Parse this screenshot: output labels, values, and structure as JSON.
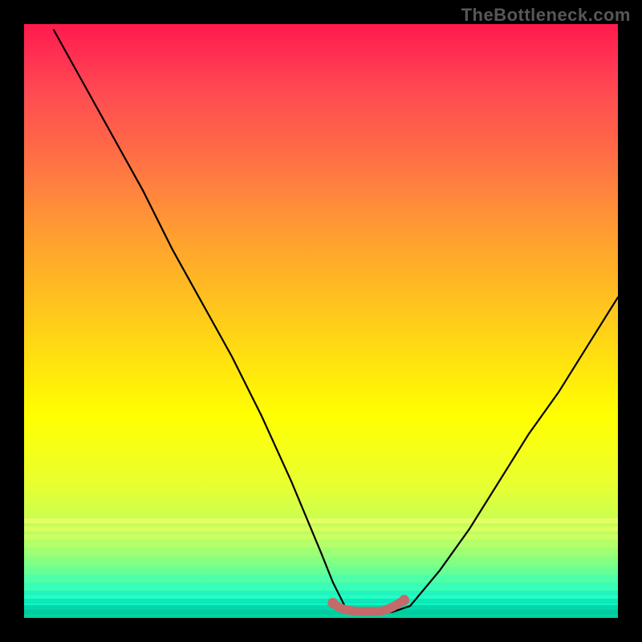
{
  "watermark": "TheBottleneck.com",
  "chart_data": {
    "type": "line",
    "title": "",
    "xlabel": "",
    "ylabel": "",
    "xlim": [
      0,
      100
    ],
    "ylim": [
      0,
      100
    ],
    "series": [
      {
        "name": "bottleneck-curve",
        "x": [
          5,
          10,
          15,
          20,
          25,
          30,
          35,
          40,
          45,
          50,
          52,
          54,
          56,
          58,
          60,
          62,
          65,
          70,
          75,
          80,
          85,
          90,
          95,
          100
        ],
        "y": [
          99,
          90,
          81,
          72,
          62,
          53,
          44,
          34,
          23,
          11,
          6,
          2,
          1,
          1,
          1,
          1,
          2,
          8,
          15,
          23,
          31,
          38,
          46,
          54
        ]
      },
      {
        "name": "optimal-band",
        "x": [
          52,
          53,
          54,
          56,
          58,
          60,
          61,
          62,
          63,
          64
        ],
        "y": [
          2.5,
          1.8,
          1.4,
          1.1,
          1.1,
          1.1,
          1.4,
          1.8,
          2.4,
          3.0
        ]
      }
    ],
    "colors": {
      "curve": "#000000",
      "optimal_band": "#c46a6a",
      "gradient_top": "#ff1a4d",
      "gradient_mid": "#ffff00",
      "gradient_bottom": "#00cc99"
    }
  }
}
